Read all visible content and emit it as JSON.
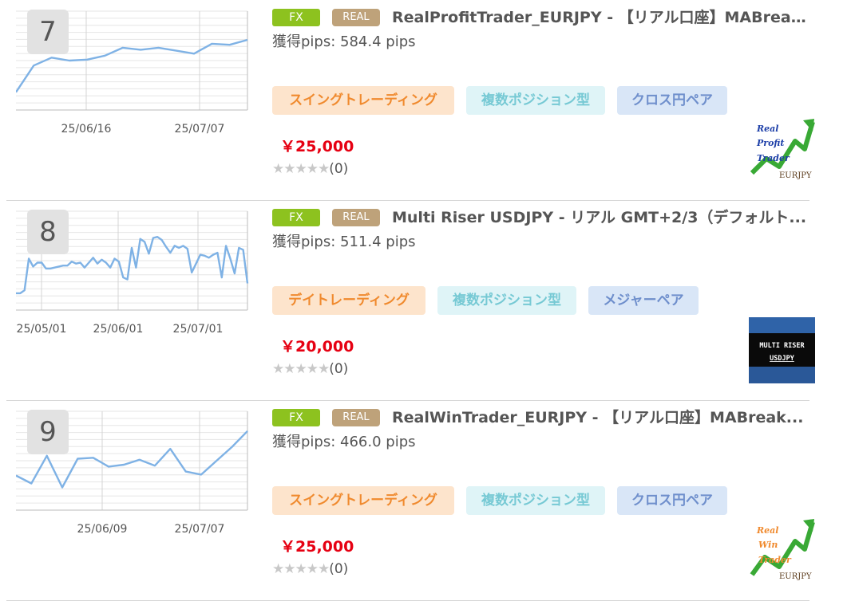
{
  "rows": [
    {
      "rank": "7",
      "badge_fx": "FX",
      "badge_real": "REAL",
      "title": "RealProfitTrader_EURJPY - 【リアル口座】MABreak...",
      "pips": "獲得pips: 584.4 pips",
      "tags": [
        "スイングトレーディング",
        "複数ポジション型",
        "クロス円ペア"
      ],
      "price": "￥25,000",
      "stars": "★★★★★",
      "review_count": "(0)",
      "thumb_text": [
        "Real",
        "Profit",
        "Trader",
        "EURJPY"
      ],
      "chart_data": {
        "type": "line",
        "x_tick_labels": [
          "25/06/16",
          "25/07/07"
        ],
        "values": [
          0.18,
          0.45,
          0.53,
          0.5,
          0.51,
          0.55,
          0.63,
          0.61,
          0.63,
          0.6,
          0.57,
          0.67,
          0.66,
          0.71
        ],
        "ylim": [
          0,
          1
        ],
        "color": "#7fb2e5"
      }
    },
    {
      "rank": "8",
      "badge_fx": "FX",
      "badge_real": "REAL",
      "title": "Multi Riser USDJPY - リアル GMT+2/3（デフォルト...",
      "pips": "獲得pips: 511.4 pips",
      "tags": [
        "デイトレーディング",
        "複数ポジション型",
        "メジャーペア"
      ],
      "price": "￥20,000",
      "stars": "★★★★★",
      "review_count": "(0)",
      "thumb_text": [
        "MULTI RISER",
        "USDJPY"
      ],
      "chart_data": {
        "type": "line",
        "x_tick_labels": [
          "25/05/01",
          "25/06/01",
          "25/07/01"
        ],
        "values": [
          0.17,
          0.17,
          0.2,
          0.52,
          0.44,
          0.48,
          0.48,
          0.42,
          0.42,
          0.43,
          0.44,
          0.45,
          0.45,
          0.49,
          0.47,
          0.48,
          0.43,
          0.48,
          0.53,
          0.47,
          0.51,
          0.48,
          0.43,
          0.52,
          0.49,
          0.33,
          0.31,
          0.63,
          0.43,
          0.72,
          0.69,
          0.57,
          0.73,
          0.74,
          0.71,
          0.64,
          0.58,
          0.65,
          0.63,
          0.65,
          0.62,
          0.38,
          0.47,
          0.56,
          0.55,
          0.53,
          0.56,
          0.58,
          0.33,
          0.65,
          0.52,
          0.37,
          0.63,
          0.61,
          0.27
        ],
        "ylim": [
          0,
          1
        ],
        "color": "#7fb2e5"
      }
    },
    {
      "rank": "9",
      "badge_fx": "FX",
      "badge_real": "REAL",
      "title": "RealWinTrader_EURJPY - 【リアル口座】MABreak...",
      "pips": "獲得pips: 466.0 pips",
      "tags": [
        "スイングトレーディング",
        "複数ポジション型",
        "クロス円ペア"
      ],
      "price": "￥25,000",
      "stars": "★★★★★",
      "review_count": "(0)",
      "thumb_text": [
        "Real",
        "Win",
        "Trader",
        "EURJPY"
      ],
      "chart_data": {
        "type": "line",
        "x_tick_labels": [
          "25/06/09",
          "25/07/07"
        ],
        "values": [
          0.35,
          0.27,
          0.55,
          0.23,
          0.52,
          0.53,
          0.44,
          0.46,
          0.51,
          0.45,
          0.62,
          0.39,
          0.36,
          0.5,
          0.64,
          0.8
        ],
        "ylim": [
          0,
          1
        ],
        "color": "#7fb2e5"
      }
    }
  ],
  "colors": {
    "badge_fx": "#8dc21f",
    "badge_real": "#bea27a",
    "price": "#e60012",
    "tag_orange_text": "#f08a2e",
    "tag_cyan_text": "#76c9d4",
    "tag_blue_text": "#6f8fcc"
  }
}
